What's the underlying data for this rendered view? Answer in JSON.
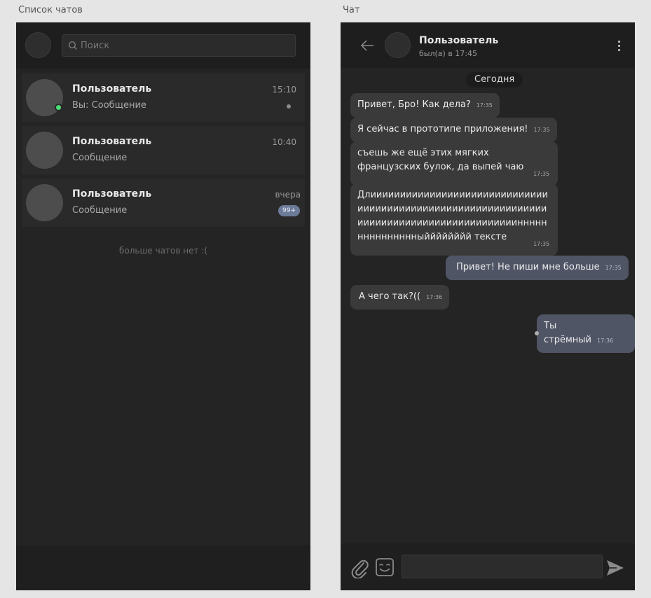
{
  "frames": {
    "list_label": "Список чатов",
    "chat_label": "Чат"
  },
  "list": {
    "search": {
      "placeholder": "Поиск",
      "value": ""
    },
    "chats": [
      {
        "name": "Пользователь",
        "message": "Вы: Сообщение",
        "time": "15:10",
        "online": true,
        "read_indicator": true
      },
      {
        "name": "Пользователь",
        "message": "Сообщение",
        "time": "10:40"
      },
      {
        "name": "Пользователь",
        "message": "Сообщение",
        "time": "вчера",
        "badge": "99+"
      }
    ],
    "no_more": "больше чатов нет :("
  },
  "chat": {
    "peer_name": "Пользователь",
    "peer_status": "был(а) в 17:45",
    "date_chip": "Сегодня",
    "messages": [
      {
        "direction": "in",
        "text": "Привет, Бро! Как дела?",
        "time": "17:35"
      },
      {
        "direction": "in",
        "text": "Я сейчас в прототипе приложения!",
        "time": "17:35"
      },
      {
        "direction": "in",
        "text": "съешь же ещё этих мягких французских булок, да выпей чаю",
        "time": "17:35"
      },
      {
        "direction": "in",
        "text": "Длиииииииииииииииииииииииииииииииииииииииииииииииииииииииииииииииииииииииииииииииииииииииииннннннннннннннныйййййййй тексте",
        "time": "17:35"
      },
      {
        "direction": "out",
        "text": "Привет! Не пиши мне больше",
        "time": "17:35"
      },
      {
        "direction": "in",
        "text": "А чего так?((",
        "time": "17:36"
      },
      {
        "direction": "out",
        "text": "Ты стрёмный",
        "time": "17:36"
      }
    ],
    "input": {
      "placeholder": "",
      "value": ""
    }
  },
  "icons": {
    "search": "search-icon",
    "back": "arrow-left-icon",
    "menu": "more-vertical-icon",
    "attach": "paperclip-icon",
    "emoji": "emoji-icon",
    "send": "send-icon"
  },
  "colors": {
    "online": "#4ce07a",
    "outgoing_bubble": "#505566",
    "incoming_bubble": "#3a3a3a",
    "badge": "#6c7b99"
  }
}
